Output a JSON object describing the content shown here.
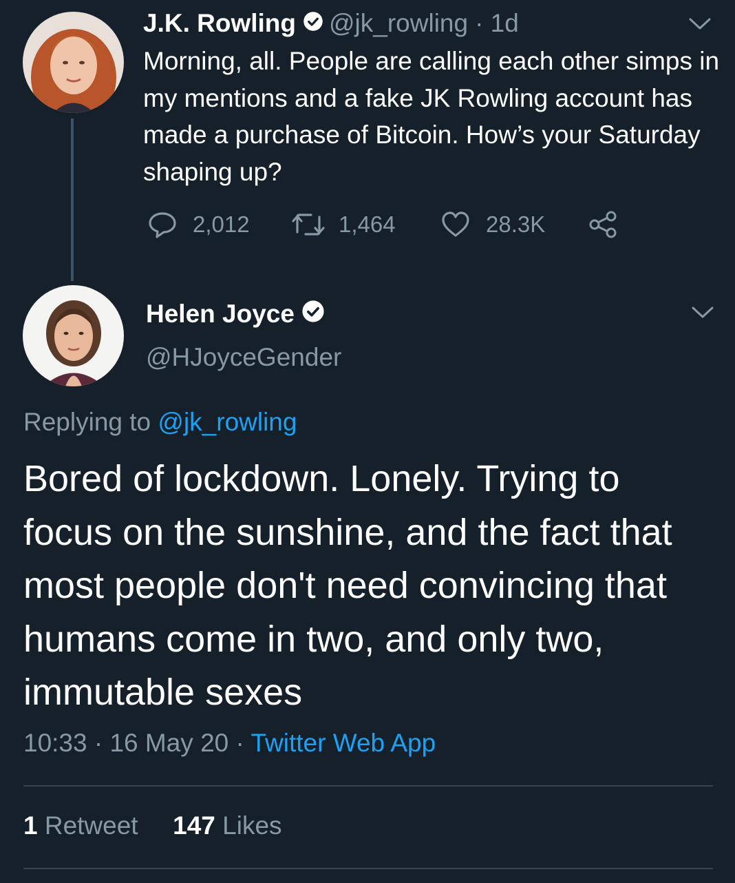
{
  "parent_tweet": {
    "name": "J.K. Rowling",
    "handle": "@jk_rowling",
    "time": "· 1d",
    "text": "Morning, all. People are calling each other simps in my mentions and a fake JK Rowling account has made a purchase of Bitcoin. How’s your Saturday shaping up?",
    "replies": "2,012",
    "retweets": "1,464",
    "likes": "28.3K",
    "verified": true
  },
  "reply_tweet": {
    "name": "Helen Joyce",
    "handle": "@HJoyceGender",
    "verified": true,
    "replying_prefix": "Replying to ",
    "replying_to": "@jk_rowling",
    "text": "Bored of lockdown. Lonely. Trying to focus on the sunshine, and the fact that most people don't need convincing that humans come in two, and only two, immutable sexes",
    "timestamp": "10:33 · 16 May 20 · ",
    "source": "Twitter Web App",
    "retweet_count": "1",
    "retweet_label": " Retweet",
    "like_count": "147",
    "like_label": " Likes"
  },
  "colors": {
    "background": "#15202b",
    "muted_text": "#8899a6",
    "link": "#1da1f2",
    "divider": "#38444d"
  },
  "icons": [
    "verified-badge-icon",
    "chevron-down-icon",
    "reply-icon",
    "retweet-icon",
    "like-icon",
    "share-icon"
  ]
}
